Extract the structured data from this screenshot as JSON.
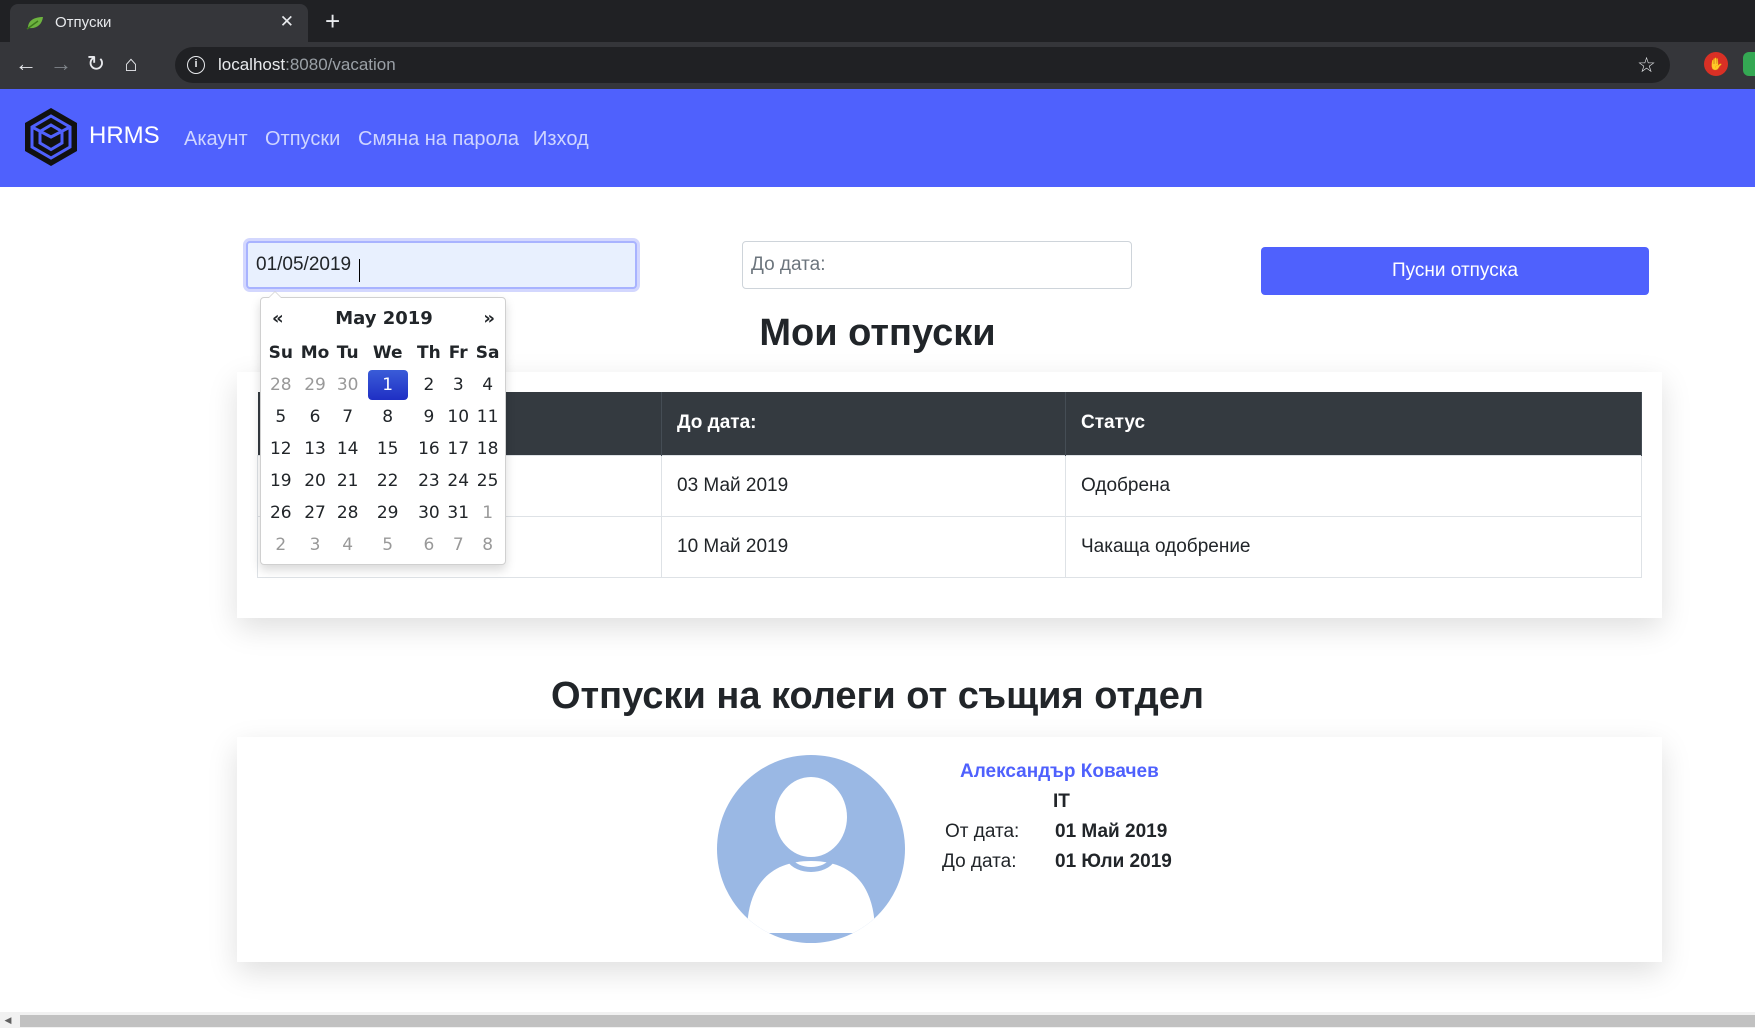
{
  "browser": {
    "tab_title": "Отпуски",
    "url_host": "localhost",
    "url_rest": ":8080/vacation"
  },
  "navbar": {
    "brand": "HRMS",
    "links": [
      "Акаунт",
      "Отпуски",
      "Смяна на парола",
      "Изход"
    ]
  },
  "form": {
    "from_value": "01/05/2019",
    "to_placeholder": "До дата:",
    "submit_label": "Пусни отпуска"
  },
  "datepicker": {
    "prev": "«",
    "next": "»",
    "month_label": "May 2019",
    "weekdays": [
      "Su",
      "Mo",
      "Tu",
      "We",
      "Th",
      "Fr",
      "Sa"
    ],
    "weeks": [
      [
        "28",
        "29",
        "30",
        "1",
        "2",
        "3",
        "4"
      ],
      [
        "5",
        "6",
        "7",
        "8",
        "9",
        "10",
        "11"
      ],
      [
        "12",
        "13",
        "14",
        "15",
        "16",
        "17",
        "18"
      ],
      [
        "19",
        "20",
        "21",
        "22",
        "23",
        "24",
        "25"
      ],
      [
        "26",
        "27",
        "28",
        "29",
        "30",
        "31",
        "1"
      ],
      [
        "2",
        "3",
        "4",
        "5",
        "6",
        "7",
        "8"
      ]
    ],
    "selected": "1"
  },
  "my_vacations": {
    "title": "Мои отпуски",
    "columns": [
      "",
      "До дата:",
      "Статус"
    ],
    "rows": [
      {
        "to": "03 Май 2019",
        "status": "Одобрена"
      },
      {
        "to": "10 Май 2019",
        "status": "Чакаща одобрение"
      }
    ]
  },
  "colleagues": {
    "title": "Отпуски на колеги от същия отдел",
    "name": "Александър Ковачев",
    "department": "IT",
    "from_label": "От дата:",
    "from_value": "01 Май 2019",
    "to_label": "До дата:",
    "to_value": "01 Юли 2019"
  },
  "colors": {
    "primary": "#4f61fd",
    "table_header": "#343a40",
    "avatar": "#9ab8e4"
  }
}
